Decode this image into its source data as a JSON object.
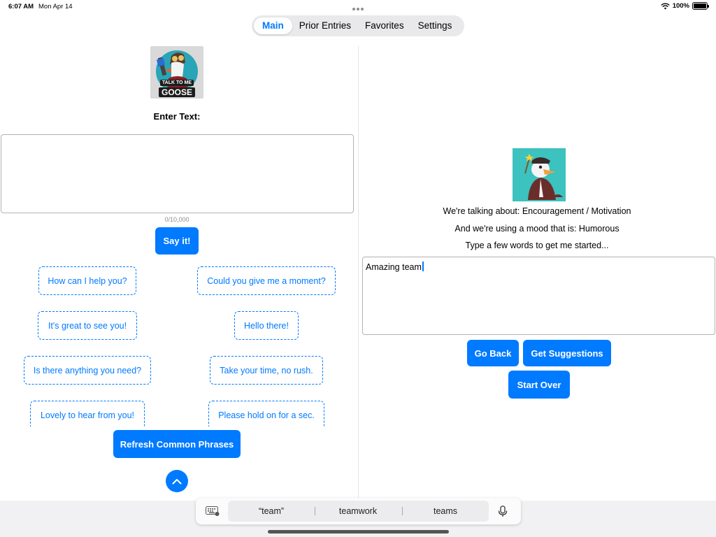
{
  "status_bar": {
    "time": "6:07 AM",
    "date": "Mon Apr 14",
    "battery": "100%",
    "battery_level": 1.0
  },
  "tabs": [
    {
      "label": "Main",
      "active": true
    },
    {
      "label": "Prior Entries",
      "active": false
    },
    {
      "label": "Favorites",
      "active": false
    },
    {
      "label": "Settings",
      "active": false
    }
  ],
  "left": {
    "logo_text": [
      "TALK TO ME",
      "GOOSE"
    ],
    "enter_label": "Enter Text:",
    "input_value": "",
    "char_count": "0/10,000",
    "say_button": "Say it!",
    "phrases": [
      "How can I help you?",
      "Could you give me a moment?",
      "It's great to see you!",
      "Hello there!",
      "Is there anything you need?",
      "Take your time, no rush.",
      "Lovely to hear from you!",
      "Please hold on for a sec."
    ],
    "refresh_button": "Refresh Common Phrases"
  },
  "right": {
    "topic_line": "We're talking about: Encouragement / Motivation",
    "mood_line": "And we're using a mood that is: Humorous",
    "prompt_line": "Type a few words to get me started...",
    "input_value": "Amazing team",
    "go_back": "Go Back",
    "get_suggestions": "Get Suggestions",
    "start_over": "Start Over"
  },
  "keyboard": {
    "suggestions": [
      "“team”",
      "teamwork",
      "teams"
    ]
  },
  "colors": {
    "accent": "#007aff",
    "panel_bg": "#ffffff",
    "segment_bg": "#e9e9eb"
  }
}
